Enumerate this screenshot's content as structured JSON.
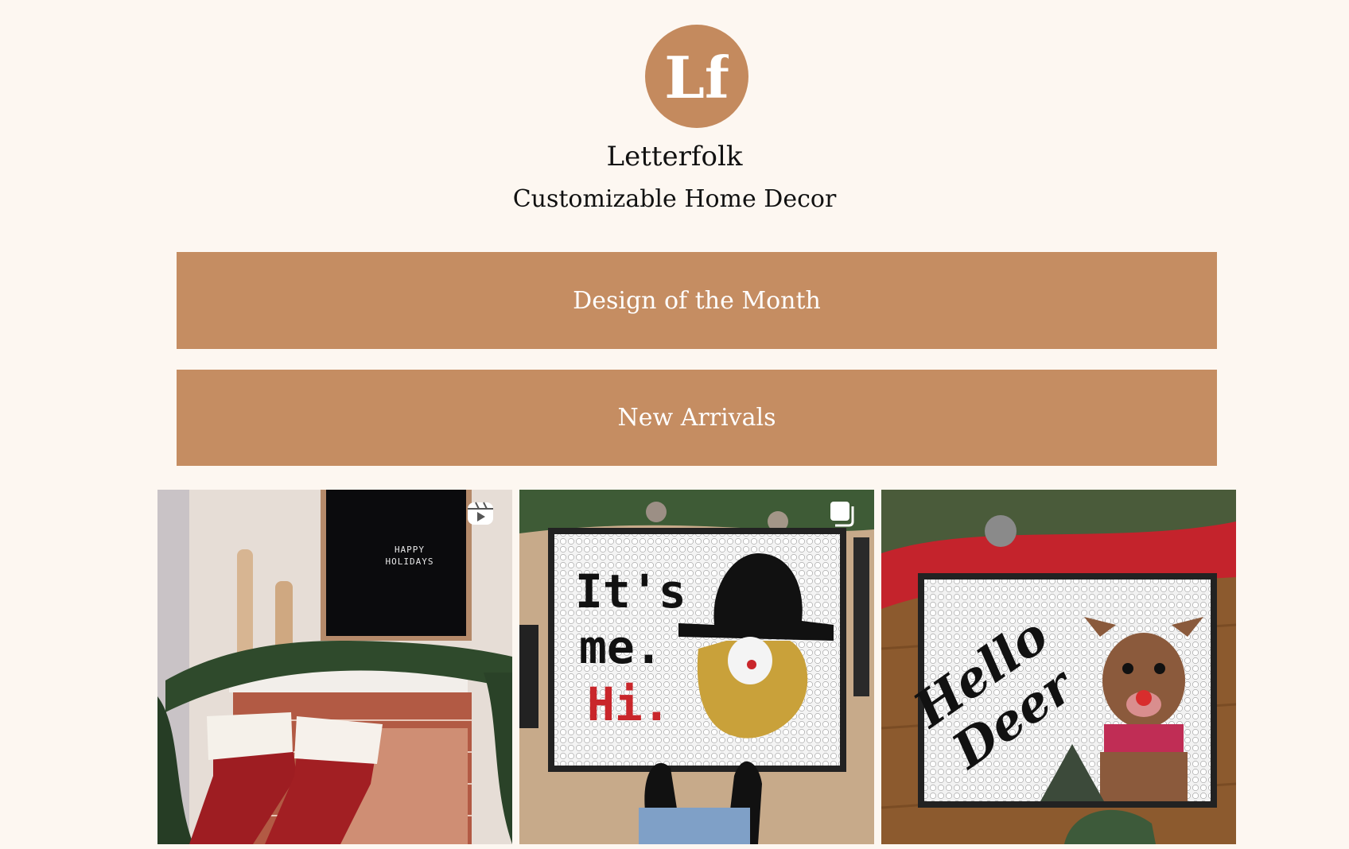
{
  "profile": {
    "name": "Letterfolk",
    "tagline": "Customizable Home Decor",
    "avatar_monogram": "Lf",
    "brand_color": "#c48a5e"
  },
  "links": [
    {
      "label": "Design of the Month"
    },
    {
      "label": "New Arrivals"
    }
  ],
  "gallery": [
    {
      "type_icon": "reel-icon",
      "sign_text": "HAPPY\nHOLIDAYS"
    },
    {
      "type_icon": "carousel-icon",
      "mat_text": "It's me. Hi."
    },
    {
      "type_icon": "none",
      "mat_text": "Hello Deer"
    }
  ]
}
